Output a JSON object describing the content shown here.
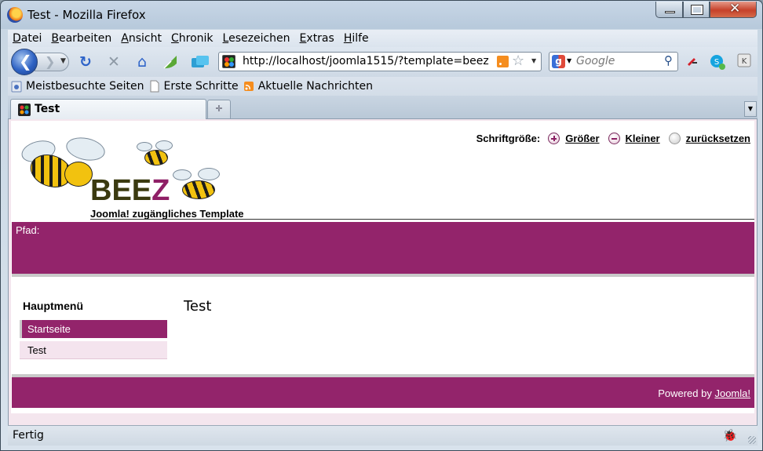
{
  "window": {
    "title": "Test - Mozilla Firefox"
  },
  "menubar": {
    "items": [
      {
        "label": "Datei",
        "accel": "D",
        "rest": "atei"
      },
      {
        "label": "Bearbeiten",
        "accel": "B",
        "rest": "earbeiten"
      },
      {
        "label": "Ansicht",
        "accel": "A",
        "rest": "nsicht"
      },
      {
        "label": "Chronik",
        "accel": "C",
        "rest": "hronik"
      },
      {
        "label": "Lesezeichen",
        "accel": "L",
        "rest": "esezeichen"
      },
      {
        "label": "Extras",
        "accel": "E",
        "rest": "xtras"
      },
      {
        "label": "Hilfe",
        "accel": "H",
        "rest": "ilfe"
      }
    ]
  },
  "navbar": {
    "url": "http://localhost/joomla1515/?template=beez",
    "search_placeholder": "Google"
  },
  "bookmarks": {
    "items": [
      "Meistbesuchte Seiten",
      "Erste Schritte",
      "Aktuelle Nachrichten"
    ]
  },
  "tabs": {
    "active_label": "Test"
  },
  "page": {
    "fontsize_label": "Schriftgröße:",
    "fontsize_bigger": "Größer",
    "fontsize_smaller": "Kleiner",
    "fontsize_reset": "zurücksetzen",
    "logo_main": "BEE",
    "logo_z": "Z",
    "tagline": "Joomla! zugängliches Template",
    "breadcrumb_label": "Pfad:",
    "menu_title": "Hauptmenü",
    "menu_items": [
      "Startseite",
      "Test"
    ],
    "content_title": "Test",
    "footer_prefix": "Powered by ",
    "footer_link": "Joomla!"
  },
  "status": {
    "text": "Fertig"
  },
  "colors": {
    "accent": "#93246b",
    "menu_item_bg": "#f4e4ee",
    "logo_text": "#3b3a10"
  }
}
